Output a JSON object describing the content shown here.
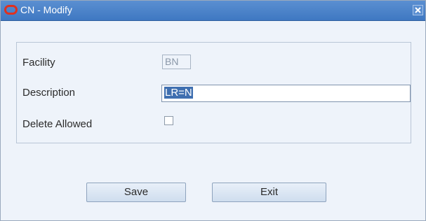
{
  "window": {
    "title": "CN - Modify",
    "logo_icon": "oracle-logo-icon",
    "close_icon": "close-icon",
    "colors": {
      "titlebar": "#4a82c8",
      "logo": "#e0311f",
      "panel": "#eef3fa"
    }
  },
  "form": {
    "facility_label": "Facility",
    "facility_value": "BN",
    "description_label": "Description",
    "description_value": "LR=N",
    "delete_allowed_label": "Delete Allowed",
    "delete_allowed_checked": false
  },
  "buttons": {
    "save": "Save",
    "exit": "Exit"
  }
}
